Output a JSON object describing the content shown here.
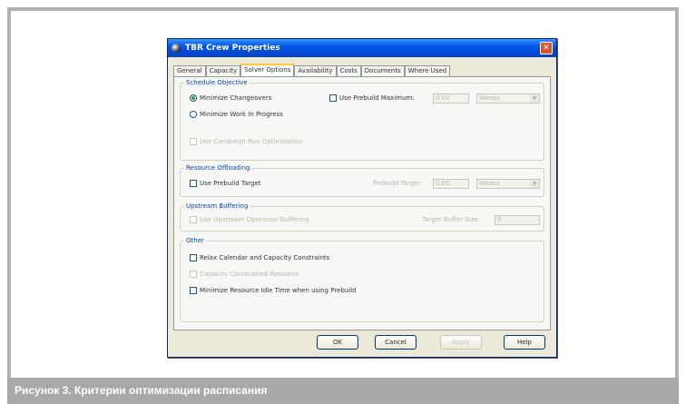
{
  "dialog": {
    "title": "TBR Crew Properties",
    "close_label": "✕"
  },
  "tabs": [
    "General",
    "Capacity",
    "Solver Options",
    "Availability",
    "Costs",
    "Documents",
    "Where Used"
  ],
  "schedule_objective": {
    "label": "Schedule Objective",
    "minimize_changeovers": "Minimize Changeovers",
    "minimize_wip": "Minimize Work In Progress",
    "use_prebuild_maximum": "Use Prebuild Maximum:",
    "prebuild_max_value": "0.00",
    "prebuild_max_unit": "Weeks",
    "use_campaign_run": "Use Campaign Run Optimization"
  },
  "resource_offloading": {
    "label": "Resource Offloading",
    "use_prebuild_target": "Use Prebuild Target",
    "prebuild_target_label": "Prebuild Target:",
    "prebuild_target_value": "0.00",
    "prebuild_target_unit": "Weeks"
  },
  "upstream_buffering": {
    "label": "Upstream Buffering",
    "use_upstream": "Use Upstream Operation Buffering",
    "target_buffer_label": "Target Buffer Size:",
    "target_buffer_value": "0"
  },
  "other": {
    "label": "Other",
    "relax_calendar": "Relax Calendar and Capacity Constraints",
    "capacity_constrained": "Capacity Constrained Resource",
    "minimize_idle": "Minimize Resource Idle Time when using Prebuild"
  },
  "buttons": {
    "ok": "OK",
    "cancel": "Cancel",
    "apply": "Apply",
    "help": "Help"
  },
  "caption": "Рисунок 3.  Критерии оптимизации расписания"
}
